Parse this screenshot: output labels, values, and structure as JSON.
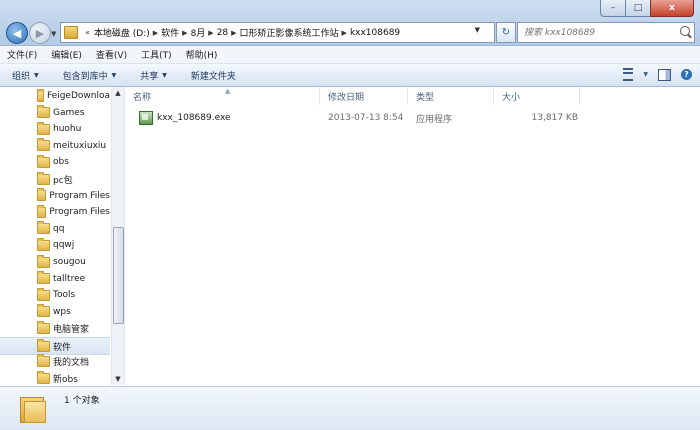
{
  "window": {
    "close_glyph": "x",
    "max_glyph": "□",
    "min_glyph": "–"
  },
  "address": {
    "crumbs": [
      "本地磁盘 (D:)",
      "软件",
      "8月",
      "28",
      "口形矫正影像系统工作站",
      "kxx108689"
    ],
    "prefix": "«"
  },
  "search": {
    "placeholder": "搜索 kxx108689"
  },
  "menu": [
    "文件(F)",
    "编辑(E)",
    "查看(V)",
    "工具(T)",
    "帮助(H)"
  ],
  "toolbar": {
    "organize": "组织",
    "include_library": "包含到库中",
    "share": "共享",
    "new_folder": "新建文件夹"
  },
  "tree": [
    "FeigeDownloa",
    "Games",
    "huohu",
    "meituxiuxiu",
    "obs",
    "pc包",
    "Program Files",
    "Program Files",
    "qq",
    "qqwj",
    "sougou",
    "talltree",
    "Tools",
    "wps",
    "电脑管家",
    "软件",
    "我的文档",
    "新obs"
  ],
  "tree_selected_index": 15,
  "columns": {
    "name": "名称",
    "modified": "修改日期",
    "type": "类型",
    "size": "大小"
  },
  "files": [
    {
      "name": "kxx_108689.exe",
      "modified": "2013-07-13 8:54",
      "type": "应用程序",
      "size": "13,817 KB"
    }
  ],
  "details": {
    "count": "1 个对象"
  },
  "colors": {
    "accent": "#2f6fb8",
    "selection": "#dae5f2",
    "folder": "#e0b448"
  }
}
